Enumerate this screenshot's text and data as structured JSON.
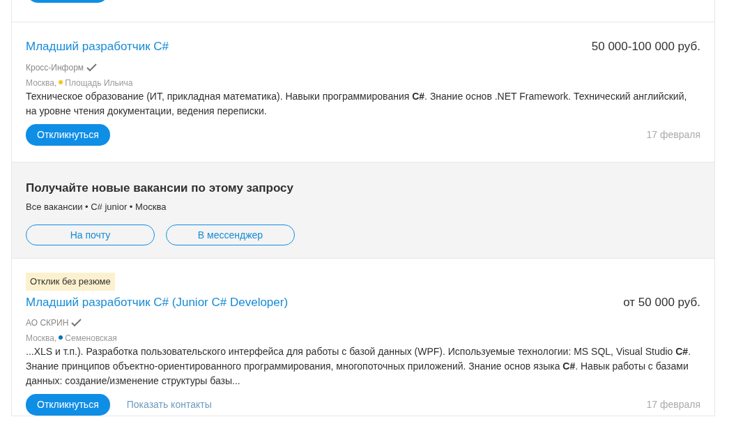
{
  "cut_off_above": {
    "kind": "button"
  },
  "vacancies": [
    {
      "title": "Младший разработчик C#",
      "salary": "50 000-100 000 руб.",
      "company": "Кросс-Информ",
      "verified": true,
      "city": "Москва,",
      "metro": {
        "station": "Площадь Ильича",
        "color": "#f5c518"
      },
      "description": [
        "Техническое образование (ИТ, прикладная математика). Навыки программирования **C#**. Знание основ .NET Framework. Технический английский, на уровне чтения документации, ведения переписки."
      ],
      "actions": [
        {
          "kind": "primary",
          "label": "Откликнуться"
        }
      ],
      "date": "17 февраля"
    },
    {
      "subscribe": {
        "title": "Получайте новые вакансии по этому запросу",
        "query": "Все вакансии • C# junior • Москва",
        "buttons": [
          "На почту",
          "В мессенджер"
        ]
      }
    },
    {
      "badge": "Отклик без резюме",
      "title": "Младший разработчик C# (Junior C# Developer)",
      "salary": "от 50 000 руб.",
      "company": "АО СКРИН",
      "verified": true,
      "city": "Москва,",
      "metro": {
        "station": "Семеновская",
        "color": "#0a74b9"
      },
      "description": [
        "...XLS и т.п.). Разработка пользовательского интерфейса для работы с базой данных (WPF). Используемые технологии: MS SQL, Visual Studio **C#**.",
        "Знание принципов объектно-ориентированного программирования, многопоточных приложений. Знание основ языка **C#**. Навык работы с базами данных: создание/изменение структуры базы..."
      ],
      "actions": [
        {
          "kind": "primary",
          "label": "Откликнуться"
        },
        {
          "kind": "link",
          "label": "Показать контакты"
        }
      ],
      "date": "17 февраля"
    }
  ]
}
